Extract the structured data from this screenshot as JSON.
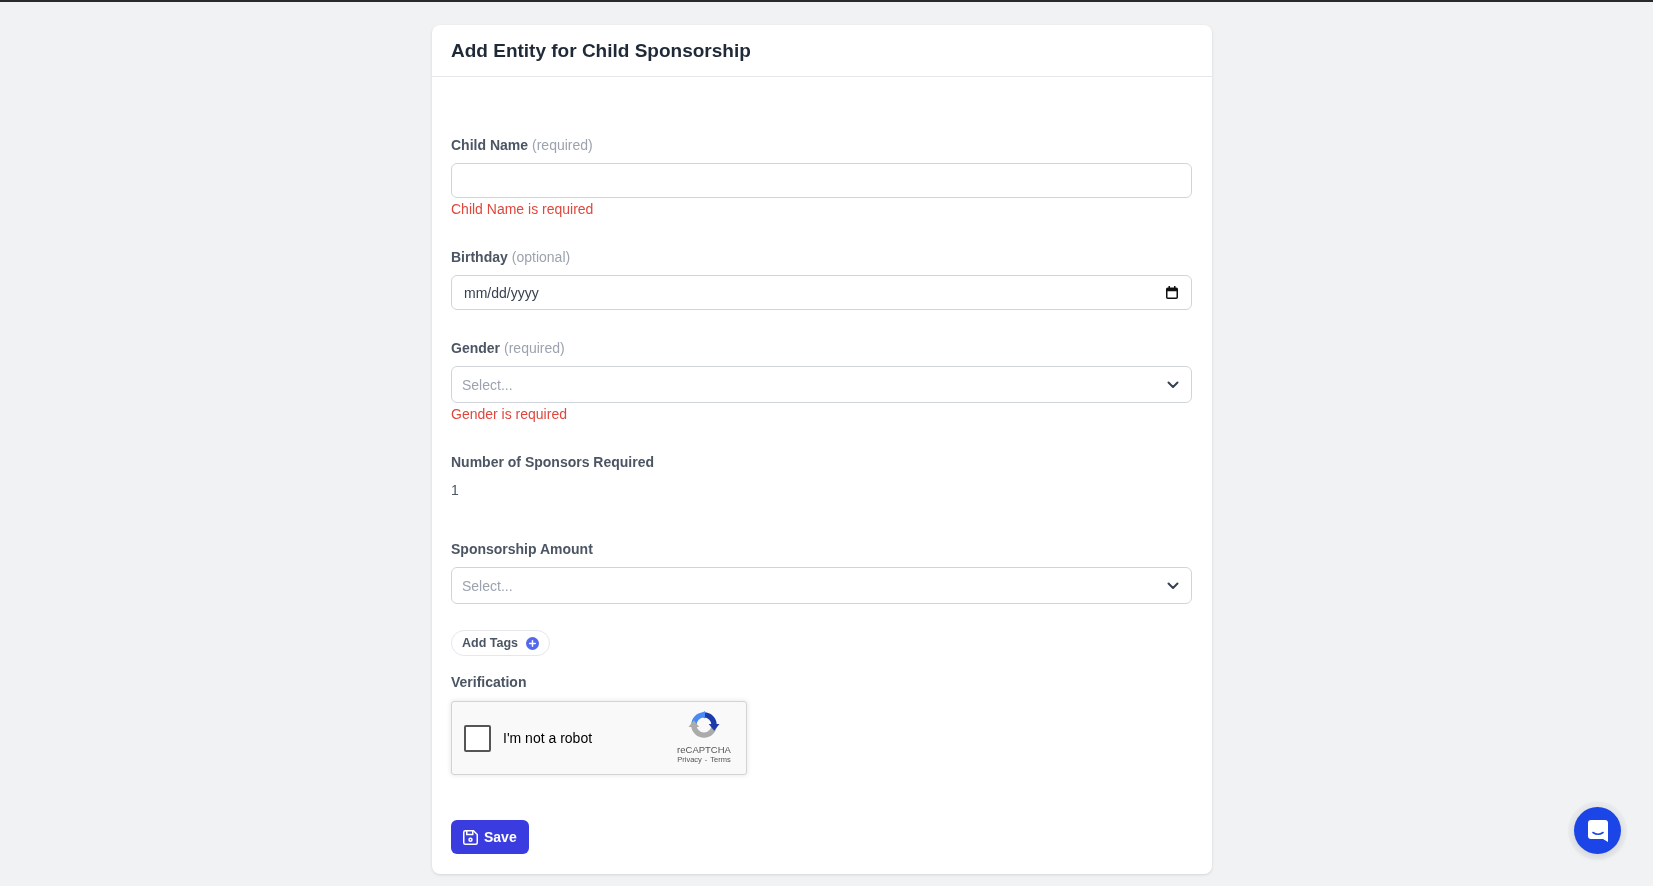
{
  "form": {
    "title": "Add Entity for Child Sponsorship",
    "fields": [
      {
        "kind": "text",
        "label": "Child Name",
        "hint": "(required)",
        "error": "Child Name is required"
      },
      {
        "kind": "date",
        "label": "Birthday",
        "hint": "(optional)",
        "placeholder": "mm/dd/yyyy"
      },
      {
        "kind": "select",
        "label": "Gender",
        "hint": "(required)",
        "placeholder": "Select...",
        "error": "Gender is required"
      },
      {
        "kind": "static",
        "label": "Number of Sponsors Required",
        "value": "1"
      },
      {
        "kind": "select",
        "label": "Sponsorship Amount",
        "placeholder": "Select..."
      }
    ],
    "add_tags_button": {
      "label": "Add Tags"
    },
    "verification": {
      "label": "Verification",
      "captcha": {
        "checked": false,
        "label": "I'm not a robot",
        "brand": "reCAPTCHA",
        "links": [
          "Privacy",
          "Terms"
        ],
        "separator": "-"
      }
    },
    "save_button": {
      "label": "Save"
    }
  }
}
